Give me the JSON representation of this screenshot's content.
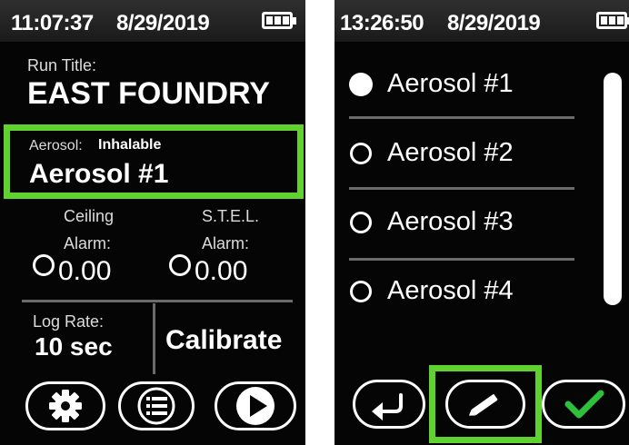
{
  "left_screen": {
    "status": {
      "time": "11:07:37",
      "date": "8/29/2019",
      "battery_icon": "battery-icon"
    },
    "run_title_label": "Run Title:",
    "run_title_value": "EAST FOUNDRY",
    "aerosol_label": "Aerosol:",
    "aerosol_type": "Inhalable",
    "aerosol_value": "Aerosol #1",
    "ceiling_label": "Ceiling",
    "ceiling_alarm_label": "Alarm:",
    "ceiling_alarm_value": "0.00",
    "stel_label": "S.T.E.L.",
    "stel_alarm_label": "Alarm:",
    "stel_alarm_value": "0.00",
    "log_rate_label": "Log Rate:",
    "log_rate_value": "10 sec",
    "calibrate_label": "Calibrate",
    "toolbar": [
      "gear-icon",
      "list-icon",
      "play-icon"
    ],
    "highlight_color": "#5fd22f"
  },
  "right_screen": {
    "status": {
      "time": "13:26:50",
      "date": "8/29/2019",
      "battery_icon": "battery-icon"
    },
    "options": [
      {
        "label": "Aerosol #1",
        "selected": true
      },
      {
        "label": "Aerosol #2",
        "selected": false
      },
      {
        "label": "Aerosol #3",
        "selected": false
      },
      {
        "label": "Aerosol #4",
        "selected": false
      }
    ],
    "toolbar": [
      "back-arrow-icon",
      "pencil-icon",
      "checkmark-icon"
    ],
    "checkmark_color": "#2fbf3a",
    "highlight_color": "#5fd22f"
  }
}
